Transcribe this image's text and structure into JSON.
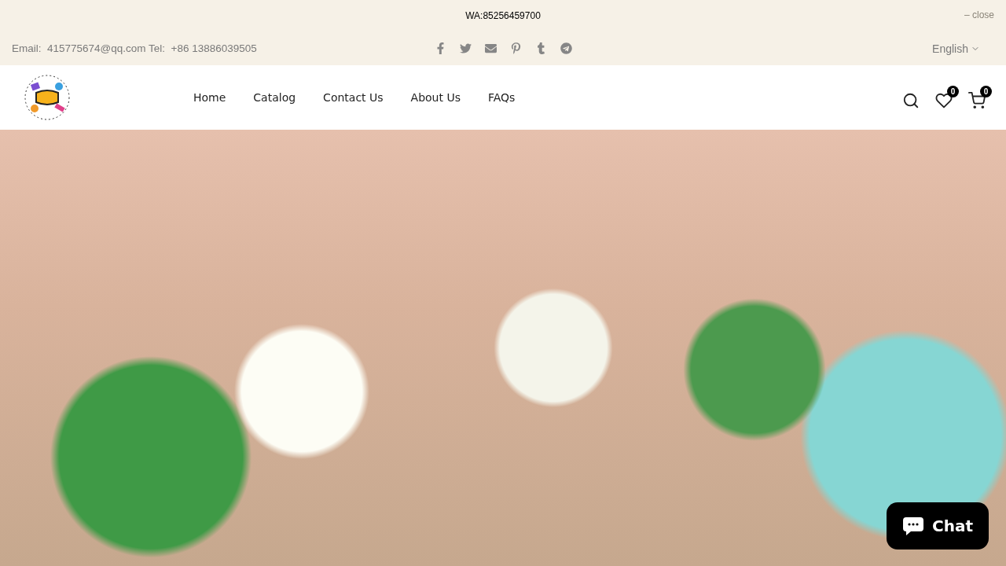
{
  "announcement": {
    "text": "WA:85256459700",
    "close": "– close"
  },
  "topbar": {
    "contact": "Email:  415775674@qq.com Tel:  +86 13886039505",
    "social": [
      {
        "kind": "facebook"
      },
      {
        "kind": "twitter"
      },
      {
        "kind": "email"
      },
      {
        "kind": "pinterest"
      },
      {
        "kind": "tumblr"
      },
      {
        "kind": "telegram"
      }
    ],
    "language": "English"
  },
  "nav": {
    "items": [
      {
        "label": "Home"
      },
      {
        "label": "Catalog"
      },
      {
        "label": "Contact Us"
      },
      {
        "label": "About Us"
      },
      {
        "label": "FAQs"
      }
    ],
    "wishlist_count": "0",
    "cart_count": "0"
  },
  "chat": {
    "label": "Chat"
  }
}
